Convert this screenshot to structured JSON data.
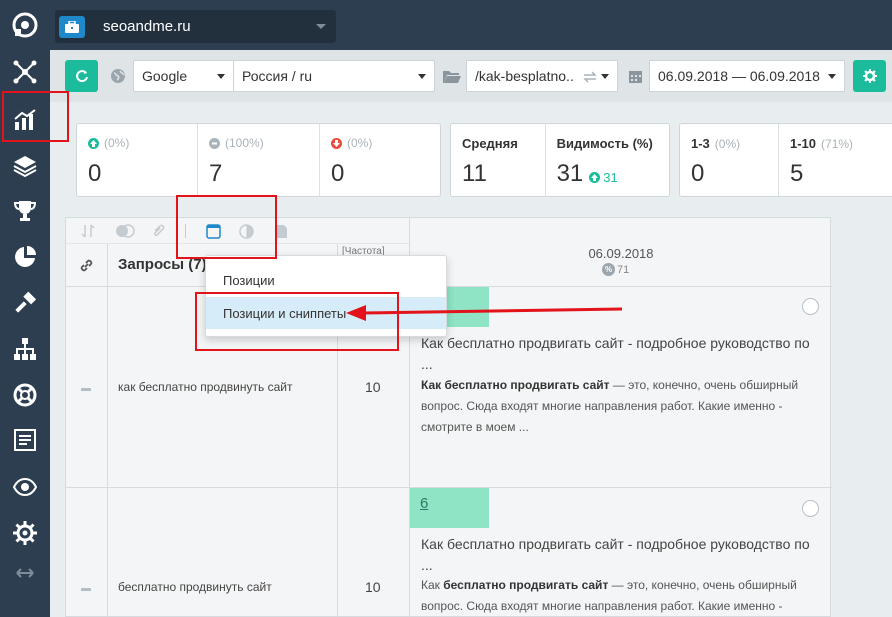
{
  "topbar": {
    "project_name": "seoandme.ru"
  },
  "toolbar": {
    "engine": "Google",
    "region": "Россия / ru",
    "folder": "/kak-besplatno..",
    "date_range": "06.09.2018 — 06.09.2018"
  },
  "stats": {
    "up": {
      "pct": "(0%)",
      "value": "0"
    },
    "same": {
      "pct": "(100%)",
      "value": "7"
    },
    "down": {
      "pct": "(0%)",
      "value": "0"
    },
    "avg": {
      "label": "Средняя",
      "value": "11"
    },
    "visibility": {
      "label": "Видимость (%)",
      "value": "31",
      "delta": "31"
    },
    "top3": {
      "label": "1-3",
      "pct": "(0%)",
      "value": "0"
    },
    "top10": {
      "label": "1-10",
      "pct": "(71%)",
      "value": "5"
    }
  },
  "table": {
    "queries_header": "Запросы (7)",
    "freq_header": "[Частота]",
    "date_header": "06.09.2018",
    "date_sub": "71",
    "rows": [
      {
        "query": "как бесплатно продвинуть сайт",
        "freq": "10",
        "position": "",
        "snippet_title": "Как бесплатно продвигать сайт - подробное руководство по ...",
        "snippet_bold": "Как бесплатно продвигать сайт",
        "snippet_text": " — это, конечно, очень обширный вопрос. Сюда входят многие направления работ. Какие именно - смотрите в моем ..."
      },
      {
        "query": "бесплатно продвинуть сайт",
        "freq": "10",
        "position": "6",
        "snippet_title": "Как бесплатно продвигать сайт - подробное руководство по ...",
        "snippet_pre": "Как ",
        "snippet_bold": "бесплатно продвигать сайт",
        "snippet_text": " — это, конечно, очень обширный вопрос. Сюда входят многие направления работ. Какие именно -"
      }
    ]
  },
  "dropdown": {
    "items": [
      "Позиции",
      "Позиции и сниппеты"
    ]
  },
  "colors": {
    "accent": "#1abc9c",
    "sidebar": "#2c3e50",
    "annotation": "#e3131b"
  }
}
